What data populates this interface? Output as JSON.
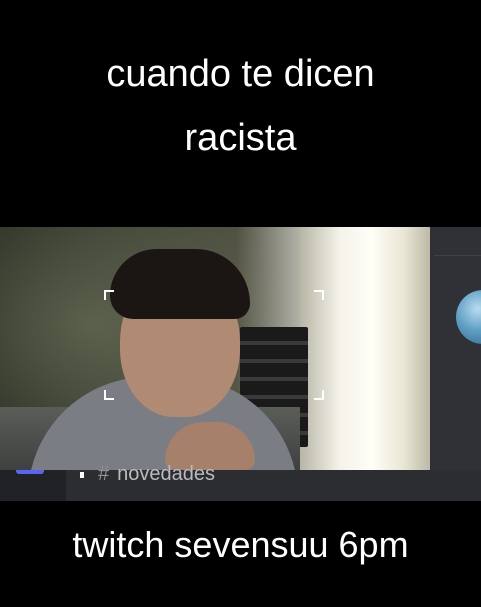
{
  "caption_top": {
    "line1": "cuando te dicen",
    "line2": "racista"
  },
  "caption_bottom": "twitch sevensuu 6pm",
  "video": {
    "channel_label": "novedades",
    "channel_symbol": "#"
  },
  "colors": {
    "background": "#000000",
    "caption_text": "#ffffff",
    "accent": "#5865f2",
    "panel": "#2b2d31"
  },
  "icons": {
    "channel": "hash-icon",
    "avatar": "user-avatar"
  }
}
